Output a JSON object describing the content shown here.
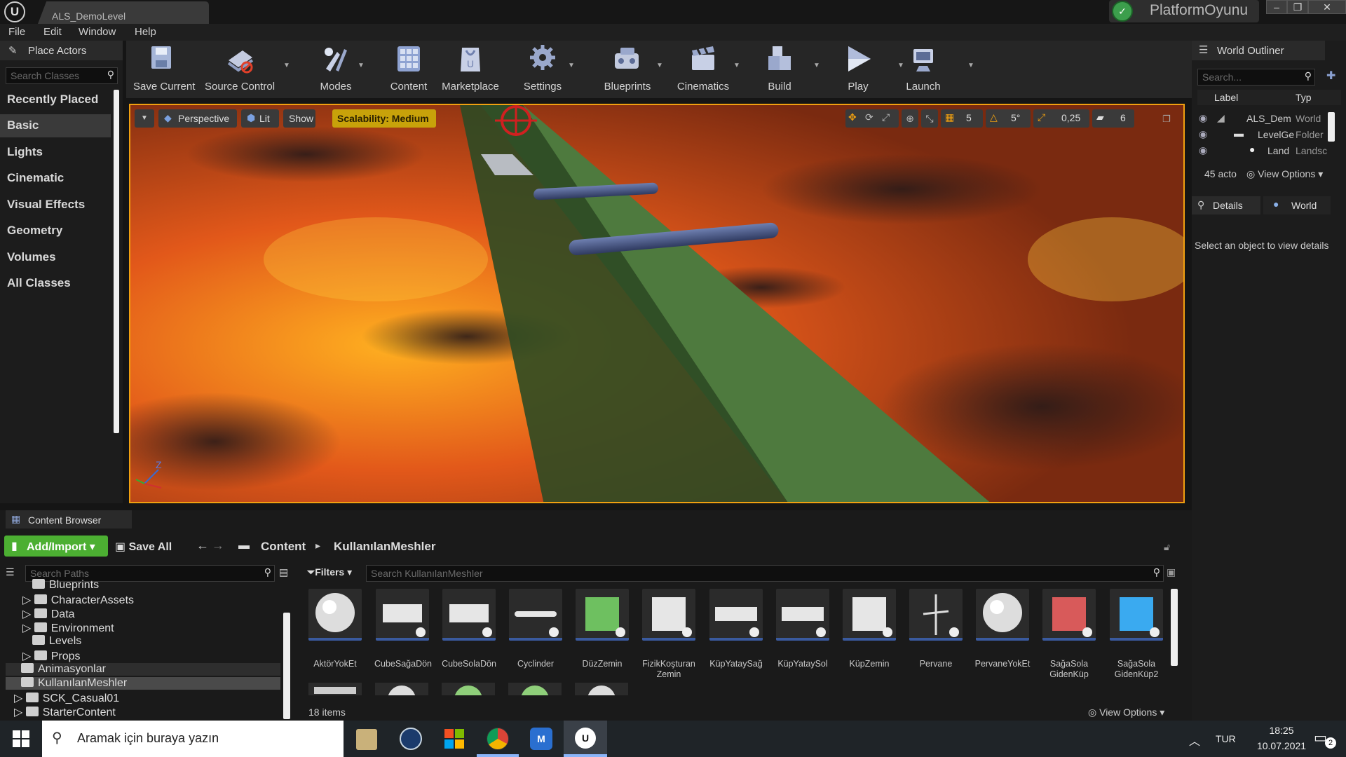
{
  "window": {
    "tab_title": "ALS_DemoLevel",
    "project_name": "PlatformOyunu",
    "engine_logo": "U"
  },
  "menu": [
    "File",
    "Edit",
    "Window",
    "Help"
  ],
  "place_actors": {
    "title": "Place Actors",
    "search_placeholder": "Search Classes",
    "categories": [
      "Recently Placed",
      "Basic",
      "Lights",
      "Cinematic",
      "Visual Effects",
      "Geometry",
      "Volumes",
      "All Classes"
    ],
    "selected": "Basic"
  },
  "toolbar": {
    "buttons": [
      "Save Current",
      "Source Control",
      "Modes",
      "Content",
      "Marketplace",
      "Settings",
      "Blueprints",
      "Cinematics",
      "Build",
      "Play",
      "Launch"
    ]
  },
  "viewport": {
    "perspective_label": "Perspective",
    "lit_label": "Lit",
    "show_label": "Show",
    "scalability_label": "Scalability: Medium",
    "grid_snap": "5",
    "rotation_snap": "5°",
    "scale_snap": "0,25",
    "camera_speed": "6",
    "axis_z": "Z"
  },
  "world_outliner": {
    "title": "World Outliner",
    "search_placeholder": "Search...",
    "col_label": "Label",
    "col_type": "Typ",
    "rows": [
      {
        "label": "ALS_Dem",
        "type": "World"
      },
      {
        "label": "LevelGe",
        "type": "Folder"
      },
      {
        "label": "Land",
        "type": "Landsc"
      }
    ],
    "count": "45 acto",
    "view_options": "View Options"
  },
  "details": {
    "tab1": "Details",
    "tab2": "World",
    "empty_msg": "Select an object to view details"
  },
  "content_browser": {
    "title": "Content Browser",
    "add_import": "Add/Import",
    "save_all": "Save All",
    "path": [
      "Content",
      "KullanılanMeshler"
    ],
    "search_paths_placeholder": "Search Paths",
    "filters_label": "Filters",
    "search_placeholder": "Search KullanılanMeshler",
    "folders": [
      "Blueprints",
      "CharacterAssets",
      "Data",
      "Environment",
      "Levels",
      "Props",
      "Animasyonlar",
      "KullanılanMeshler",
      "SCK_Casual01",
      "StarterContent"
    ],
    "selected_folder": "KullanılanMeshler",
    "assets": [
      "AktörYokEt",
      "CubeSağaDön",
      "CubeSolaDön",
      "Cyclinder",
      "DüzZemin",
      "FizikKoşturan Zemin",
      "KüpYataySağ",
      "KüpYataySol",
      "KüpZemin",
      "Pervane",
      "PervaneYokEt",
      "SağaSola GidenKüp",
      "SağaSola GidenKüp2"
    ],
    "item_count": "18 items",
    "view_options": "View Options"
  },
  "taskbar": {
    "search_text": "Aramak için buraya yazın",
    "lang": "TUR",
    "time": "18:25",
    "date": "10.07.2021",
    "notif_count": "2"
  },
  "colors": {
    "accent_green": "#4caf32",
    "scalability_yellow": "#c8a20a",
    "viewport_border": "#f0a010",
    "lava": "#e0571a"
  }
}
